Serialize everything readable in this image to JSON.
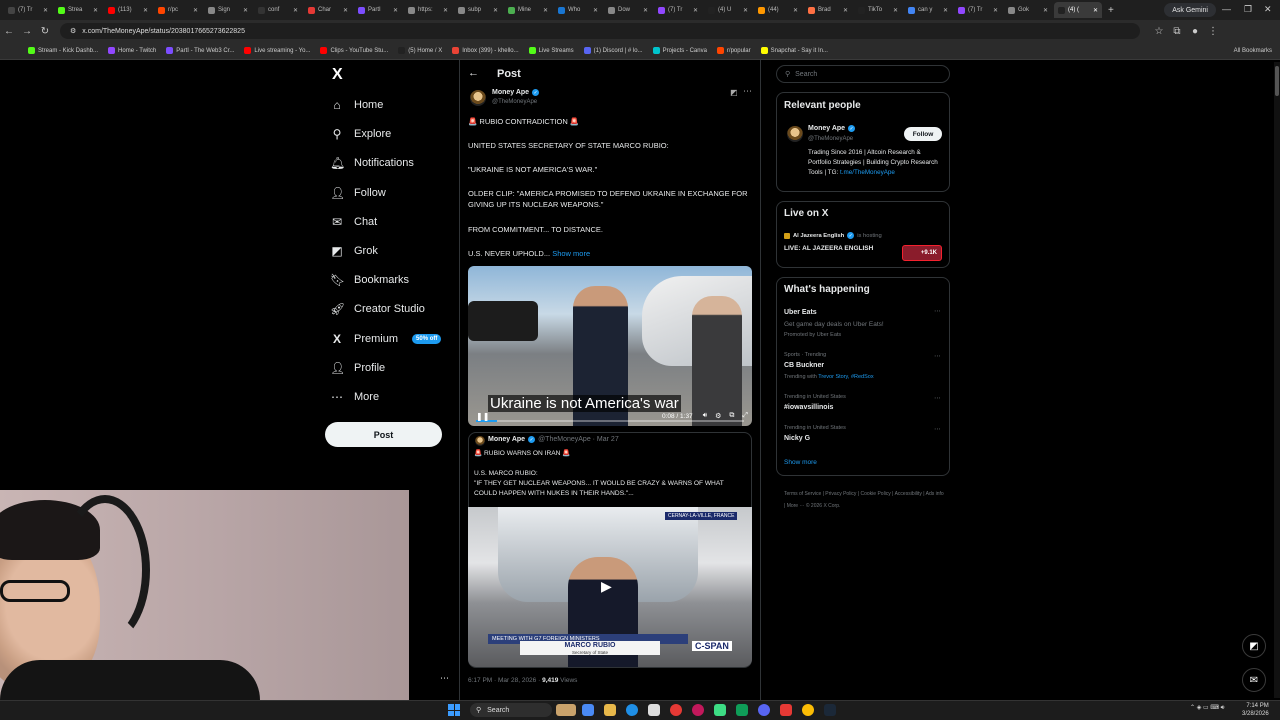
{
  "browser": {
    "tabs": [
      {
        "label": "(7) Tr",
        "color": "#444"
      },
      {
        "label": "Strea",
        "color": "#53fc18"
      },
      {
        "label": "(113)",
        "color": "#ff0000"
      },
      {
        "label": "r/pc",
        "color": "#ff4500"
      },
      {
        "label": "Sign",
        "color": "#888"
      },
      {
        "label": "conf",
        "color": "#333"
      },
      {
        "label": "Char",
        "color": "#e53935"
      },
      {
        "label": "PartI",
        "color": "#7c4dff"
      },
      {
        "label": "https:",
        "color": "#888"
      },
      {
        "label": "subp",
        "color": "#888"
      },
      {
        "label": "Mine",
        "color": "#4caf50"
      },
      {
        "label": "Who",
        "color": "#1976d2"
      },
      {
        "label": "Dow",
        "color": "#888"
      },
      {
        "label": "(7) Tr",
        "color": "#9147ff"
      },
      {
        "label": "(4) U",
        "color": "#222"
      },
      {
        "label": "(44)",
        "color": "#ff9800"
      },
      {
        "label": "Brad",
        "color": "#ff7043"
      },
      {
        "label": "TikTo",
        "color": "#222"
      },
      {
        "label": "can y",
        "color": "#4285f4"
      },
      {
        "label": "(7) Tr",
        "color": "#9147ff"
      },
      {
        "label": "Gok",
        "color": "#888"
      },
      {
        "label": "(4) (",
        "color": "#222",
        "active": true
      }
    ],
    "new_tab": "+",
    "gemini_label": "Ask Gemini",
    "url": "x.com/TheMoneyApe/status/2038017665273622825",
    "bookmarks": [
      {
        "label": "Stream - Kick Dashb...",
        "color": "#53fc18"
      },
      {
        "label": "Home - Twitch",
        "color": "#9147ff"
      },
      {
        "label": "PartI - The Web3 Cr...",
        "color": "#7c4dff"
      },
      {
        "label": "Live streaming - Yo...",
        "color": "#ff0000"
      },
      {
        "label": "Clips - YouTube Stu...",
        "color": "#ff0000"
      },
      {
        "label": "(5) Home / X",
        "color": "#222"
      },
      {
        "label": "Inbox (399) - khello...",
        "color": "#ea4335"
      },
      {
        "label": "Live Streams",
        "color": "#53fc18"
      },
      {
        "label": "(1) Discord | # lo...",
        "color": "#5865f2"
      },
      {
        "label": "Projects - Canva",
        "color": "#00c4cc"
      },
      {
        "label": "r/popular",
        "color": "#ff4500"
      },
      {
        "label": "Snapchat - Say it In...",
        "color": "#fffc00"
      }
    ],
    "all_bookmarks": "All Bookmarks"
  },
  "nav": {
    "logo": "X",
    "items": [
      {
        "label": "Home",
        "icon": "⌂",
        "icon_name": "home-icon"
      },
      {
        "label": "Explore",
        "icon": "⚲",
        "icon_name": "search-icon"
      },
      {
        "label": "Notifications",
        "icon": "🔔︎",
        "icon_name": "bell-icon"
      },
      {
        "label": "Follow",
        "icon": "👤︎",
        "icon_name": "follow-icon"
      },
      {
        "label": "Chat",
        "icon": "✉",
        "icon_name": "chat-icon"
      },
      {
        "label": "Grok",
        "icon": "◩",
        "icon_name": "grok-icon"
      },
      {
        "label": "Bookmarks",
        "icon": "🔖︎",
        "icon_name": "bookmark-icon"
      },
      {
        "label": "Creator Studio",
        "icon": "🚀︎",
        "icon_name": "rocket-icon"
      },
      {
        "label": "Premium",
        "icon": "X",
        "icon_name": "x-premium-icon",
        "badge": "50% off"
      },
      {
        "label": "Profile",
        "icon": "👤︎",
        "icon_name": "profile-icon"
      },
      {
        "label": "More",
        "icon": "⋯",
        "icon_name": "more-circle-icon"
      }
    ],
    "post_button": "Post",
    "side_more": "⋯"
  },
  "post": {
    "heading": "Post",
    "author": "Money Ape",
    "handle": "@TheMoneyApe",
    "lines": [
      "🚨 RUBIO CONTRADICTION 🚨",
      "UNITED STATES SECRETARY OF STATE MARCO RUBIO:",
      "\"UKRAINE IS NOT AMERICA'S WAR.\"",
      "OLDER CLIP: \"AMERICA PROMISED TO DEFEND UKRAINE IN EXCHANGE FOR GIVING UP ITS NUCLEAR WEAPONS.\"",
      "FROM COMMITMENT... TO DISTANCE.",
      "U.S. NEVER UPHOLD..."
    ],
    "show_more": "Show more",
    "video_caption": "Ukraine is not America's war",
    "video_time": "0:08 / 1:37",
    "video_progress": 0.08,
    "quote": {
      "author": "Money Ape",
      "handle": "@TheMoneyApe · Mar 27",
      "title": "🚨 RUBIO WARNS ON IRAN 🚨",
      "lines": [
        "U.S. MARCO RUBIO:",
        "\"IF THEY GET NUCLEAR WEAPONS... IT WOULD BE CRAZY & WARNS OF WHAT COULD HAPPEN WITH NUKES IN THEIR HANDS.\"..."
      ],
      "banner": "MEETING WITH G7 FOREIGN MINISTERS",
      "name_plate": "MARCO RUBIO",
      "name_sub": "Secretary of State",
      "network": "C-SPAN",
      "location": "CERNAY-LA-VILLE, FRANCE"
    },
    "timestamp": "6:17 PM · Mar 28, 2026 ·",
    "views": "9,419",
    "views_label": "Views"
  },
  "right": {
    "search_placeholder": "Search",
    "relevant_title": "Relevant people",
    "relevant": {
      "name": "Money Ape",
      "handle": "@TheMoneyApe",
      "follow": "Follow",
      "bio": "Trading Since 2016 | Altcoin Research & Portfolio Strategies | Building Crypto Research Tools | TG:",
      "link": "t.me/TheMoneyApe"
    },
    "live_title": "Live on X",
    "live": {
      "host": "Al Jazeera English",
      "hosting": "is hosting",
      "name": "LIVE: AL JAZEERA ENGLISH",
      "count": "+9.1K"
    },
    "happening_title": "What's happening",
    "trends": [
      {
        "context": "",
        "name": "Uber Eats",
        "sub": "Get game day deals on Uber Eats!",
        "sub2": "Promoted by Uber Eats"
      },
      {
        "context": "Sports · Trending",
        "name": "CB Buckner",
        "sub": "Trending with",
        "hl": "Trevor Story, #RedSox"
      },
      {
        "context": "Trending in United States",
        "name": "#iowavsillinois",
        "sub": ""
      },
      {
        "context": "Trending in United States",
        "name": "Nicky G",
        "sub": ""
      }
    ],
    "show_more": "Show more",
    "footer": "Terms of Service  |  Privacy Policy  |  Cookie Policy  |  Accessibility  |  Ads info  |  More ···  © 2026 X Corp."
  },
  "taskbar": {
    "search": "Search",
    "time": "7:14 PM",
    "date": "3/28/2026"
  }
}
